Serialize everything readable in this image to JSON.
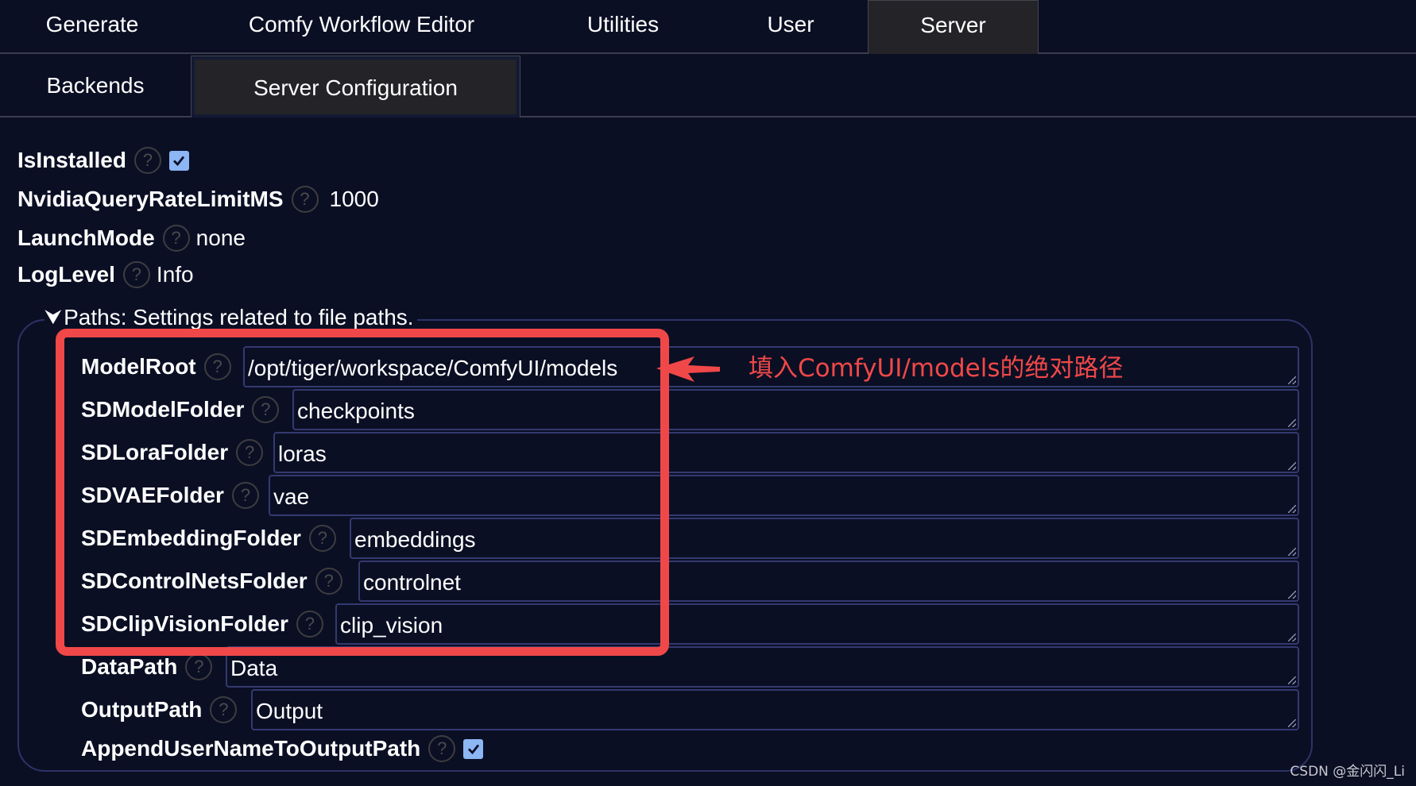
{
  "top_tabs": [
    {
      "label": "Generate"
    },
    {
      "label": "Comfy Workflow Editor"
    },
    {
      "label": "Utilities"
    },
    {
      "label": "User"
    },
    {
      "label": "Server",
      "active": true
    }
  ],
  "sub_tabs": [
    {
      "label": "Backends"
    },
    {
      "label": "Server Configuration",
      "active": true
    }
  ],
  "settings": {
    "is_installed": {
      "label": "IsInstalled",
      "checked": true
    },
    "nvidia_rate": {
      "label": "NvidiaQueryRateLimitMS",
      "value": "1000"
    },
    "launch_mode": {
      "label": "LaunchMode",
      "value": "none"
    },
    "log_level": {
      "label": "LogLevel",
      "value": "Info"
    }
  },
  "help_glyph": "?",
  "paths": {
    "legend": "Paths: Settings related to file paths.",
    "fields": [
      {
        "label": "ModelRoot",
        "value": "/opt/tiger/workspace/ComfyUI/models"
      },
      {
        "label": "SDModelFolder",
        "value": "checkpoints"
      },
      {
        "label": "SDLoraFolder",
        "value": "loras"
      },
      {
        "label": "SDVAEFolder",
        "value": "vae"
      },
      {
        "label": "SDEmbeddingFolder",
        "value": "embeddings"
      },
      {
        "label": "SDControlNetsFolder",
        "value": "controlnet"
      },
      {
        "label": "SDClipVisionFolder",
        "value": "clip_vision"
      },
      {
        "label": "DataPath",
        "value": "Data"
      },
      {
        "label": "OutputPath",
        "value": "Output"
      }
    ],
    "append_user": {
      "label": "AppendUserNameToOutputPath",
      "checked": true
    }
  },
  "annotation": {
    "text": "填入ComfyUI/models的绝对路径",
    "color": "#f04848"
  },
  "watermark": "CSDN @金闪闪_Li",
  "colors": {
    "background": "#0b0f24",
    "active_tab": "#232328",
    "checkbox": "#8cb6f4",
    "field_border": "#333a70"
  }
}
